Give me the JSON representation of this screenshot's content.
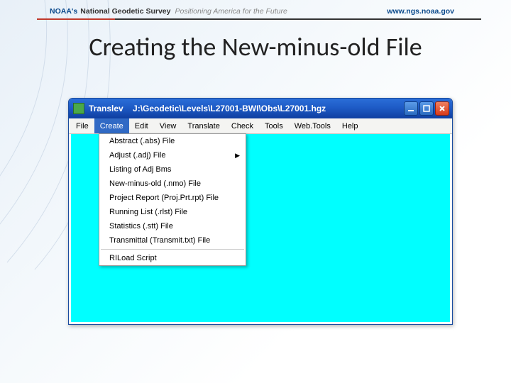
{
  "header": {
    "noaa": "NOAA's",
    "ngs": "National Geodetic Survey",
    "tagline": "Positioning America for the Future",
    "url": "www.ngs.noaa.gov"
  },
  "slide": {
    "title": "Creating the New-minus-old File"
  },
  "window": {
    "app_name": "Translev",
    "path": "J:\\Geodetic\\Levels\\L27001-BWI\\Obs\\L27001.hgz"
  },
  "menubar": {
    "items": [
      "File",
      "Create",
      "Edit",
      "View",
      "Translate",
      "Check",
      "Tools",
      "Web.Tools",
      "Help"
    ],
    "active_index": 1
  },
  "dropdown": {
    "items": [
      {
        "label": "Abstract (.abs) File",
        "has_submenu": false
      },
      {
        "label": "Adjust (.adj) File",
        "has_submenu": true
      },
      {
        "label": "Listing of Adj Bms",
        "has_submenu": false
      },
      {
        "label": "New-minus-old (.nmo) File",
        "has_submenu": false
      },
      {
        "label": "Project Report (Proj.Prt.rpt) File",
        "has_submenu": false
      },
      {
        "label": "Running List (.rlst) File",
        "has_submenu": false
      },
      {
        "label": "Statistics (.stt) File",
        "has_submenu": false
      },
      {
        "label": "Transmittal (Transmit.txt) File",
        "has_submenu": false
      }
    ],
    "after_sep": [
      {
        "label": "RILoad Script",
        "has_submenu": false
      }
    ]
  }
}
